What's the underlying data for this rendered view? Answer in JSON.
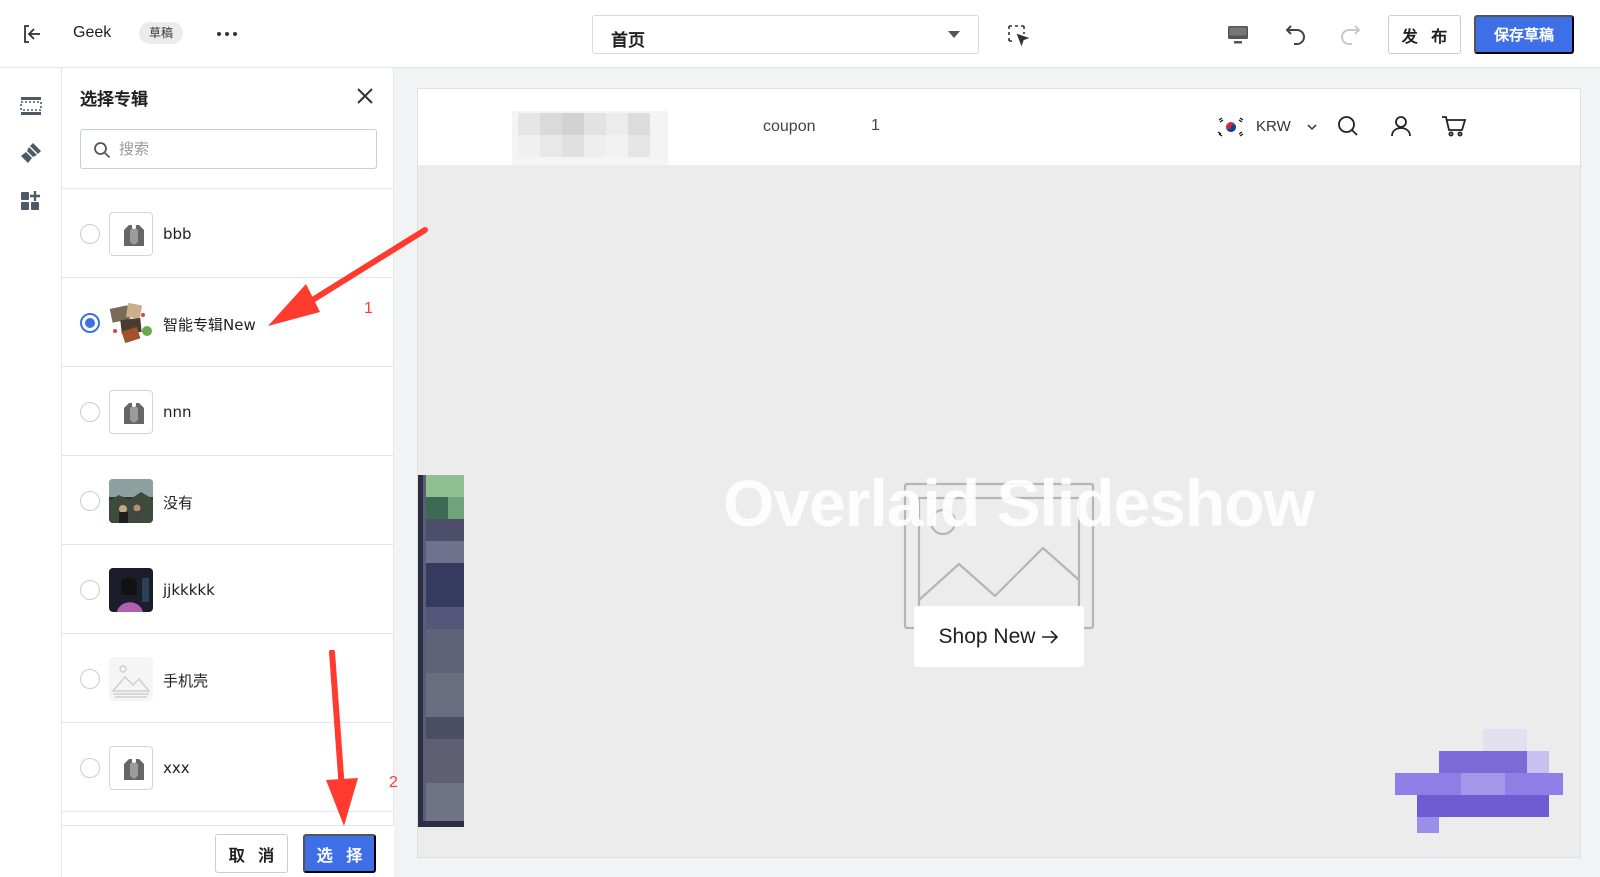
{
  "topbar": {
    "title": "Geek",
    "badge": "草稿",
    "page_select": {
      "selected": "首页"
    },
    "publish_label": "发 布",
    "save_label": "保存草稿"
  },
  "rail": {
    "icons": [
      "sections-icon",
      "theme-brush-icon",
      "apps-icon"
    ]
  },
  "panel": {
    "title": "选择专辑",
    "search_placeholder": "搜索",
    "items": [
      {
        "label": "bbb",
        "thumb": "tag-placeholder",
        "checked": false
      },
      {
        "label": "智能专辑New",
        "thumb": "photo-collage",
        "checked": true
      },
      {
        "label": "nnn",
        "thumb": "tag-placeholder",
        "checked": false
      },
      {
        "label": "没有",
        "thumb": "photo-dark-landscape",
        "checked": false
      },
      {
        "label": "jjkkkkk",
        "thumb": "photo-portrait",
        "checked": false
      },
      {
        "label": "手机壳",
        "thumb": "image-placeholder-light",
        "checked": false
      },
      {
        "label": "xxx",
        "thumb": "tag-placeholder",
        "checked": false
      }
    ],
    "cancel_label": "取 消",
    "select_label": "选 择"
  },
  "preview": {
    "nav": [
      "coupon",
      "1"
    ],
    "currency": "KRW",
    "hero_title": "Overlaid Slideshow",
    "shop_button": "Shop New"
  },
  "annotations": {
    "first": "1",
    "second": "2"
  },
  "colors": {
    "primary": "#3f6fe6",
    "annotation": "#ff3b30",
    "canvas": "#ececec"
  }
}
